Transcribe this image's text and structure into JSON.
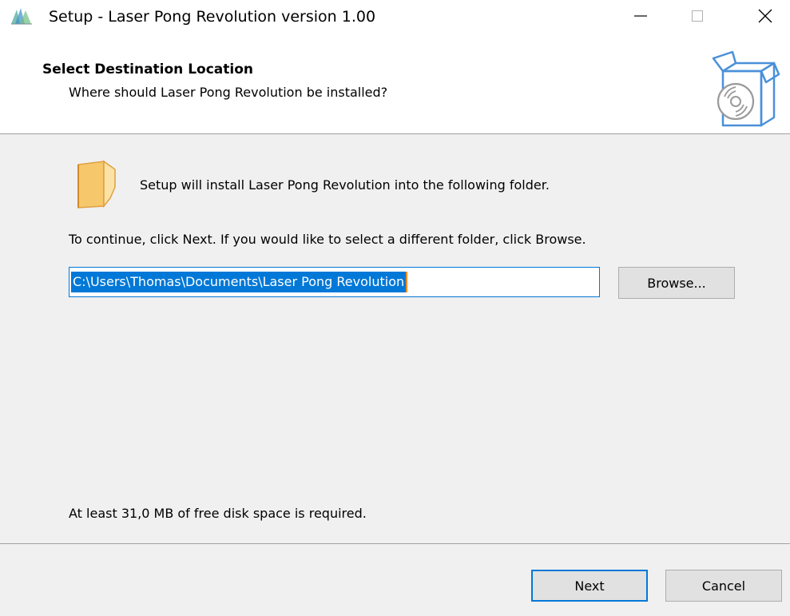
{
  "window": {
    "title": "Setup - Laser Pong Revolution version 1.00",
    "icons": {
      "app": "setup-app-icon",
      "minimize": "minimize-icon",
      "maximize": "maximize-icon",
      "close": "close-icon"
    }
  },
  "header": {
    "title": "Select Destination Location",
    "subtitle": "Where should Laser Pong Revolution be installed?",
    "icon": "software-box-icon"
  },
  "content": {
    "folder_icon": "folder-icon",
    "intro": "Setup will install Laser Pong Revolution into the following folder.",
    "instruction": "To continue, click Next. If you would like to select a different folder, click Browse.",
    "path_value": "C:\\Users\\Thomas\\Documents\\Laser Pong Revolution",
    "browse_label": "Browse...",
    "disk_space": "At least 31,0 MB of free disk space is required."
  },
  "footer": {
    "next_label": "Next",
    "cancel_label": "Cancel"
  },
  "colors": {
    "accent": "#0078d7",
    "background": "#f0f0f0",
    "header_background": "#ffffff",
    "button_face": "#e1e1e1",
    "folder": "#f6c86b",
    "box_icon": "#4a90d9"
  }
}
